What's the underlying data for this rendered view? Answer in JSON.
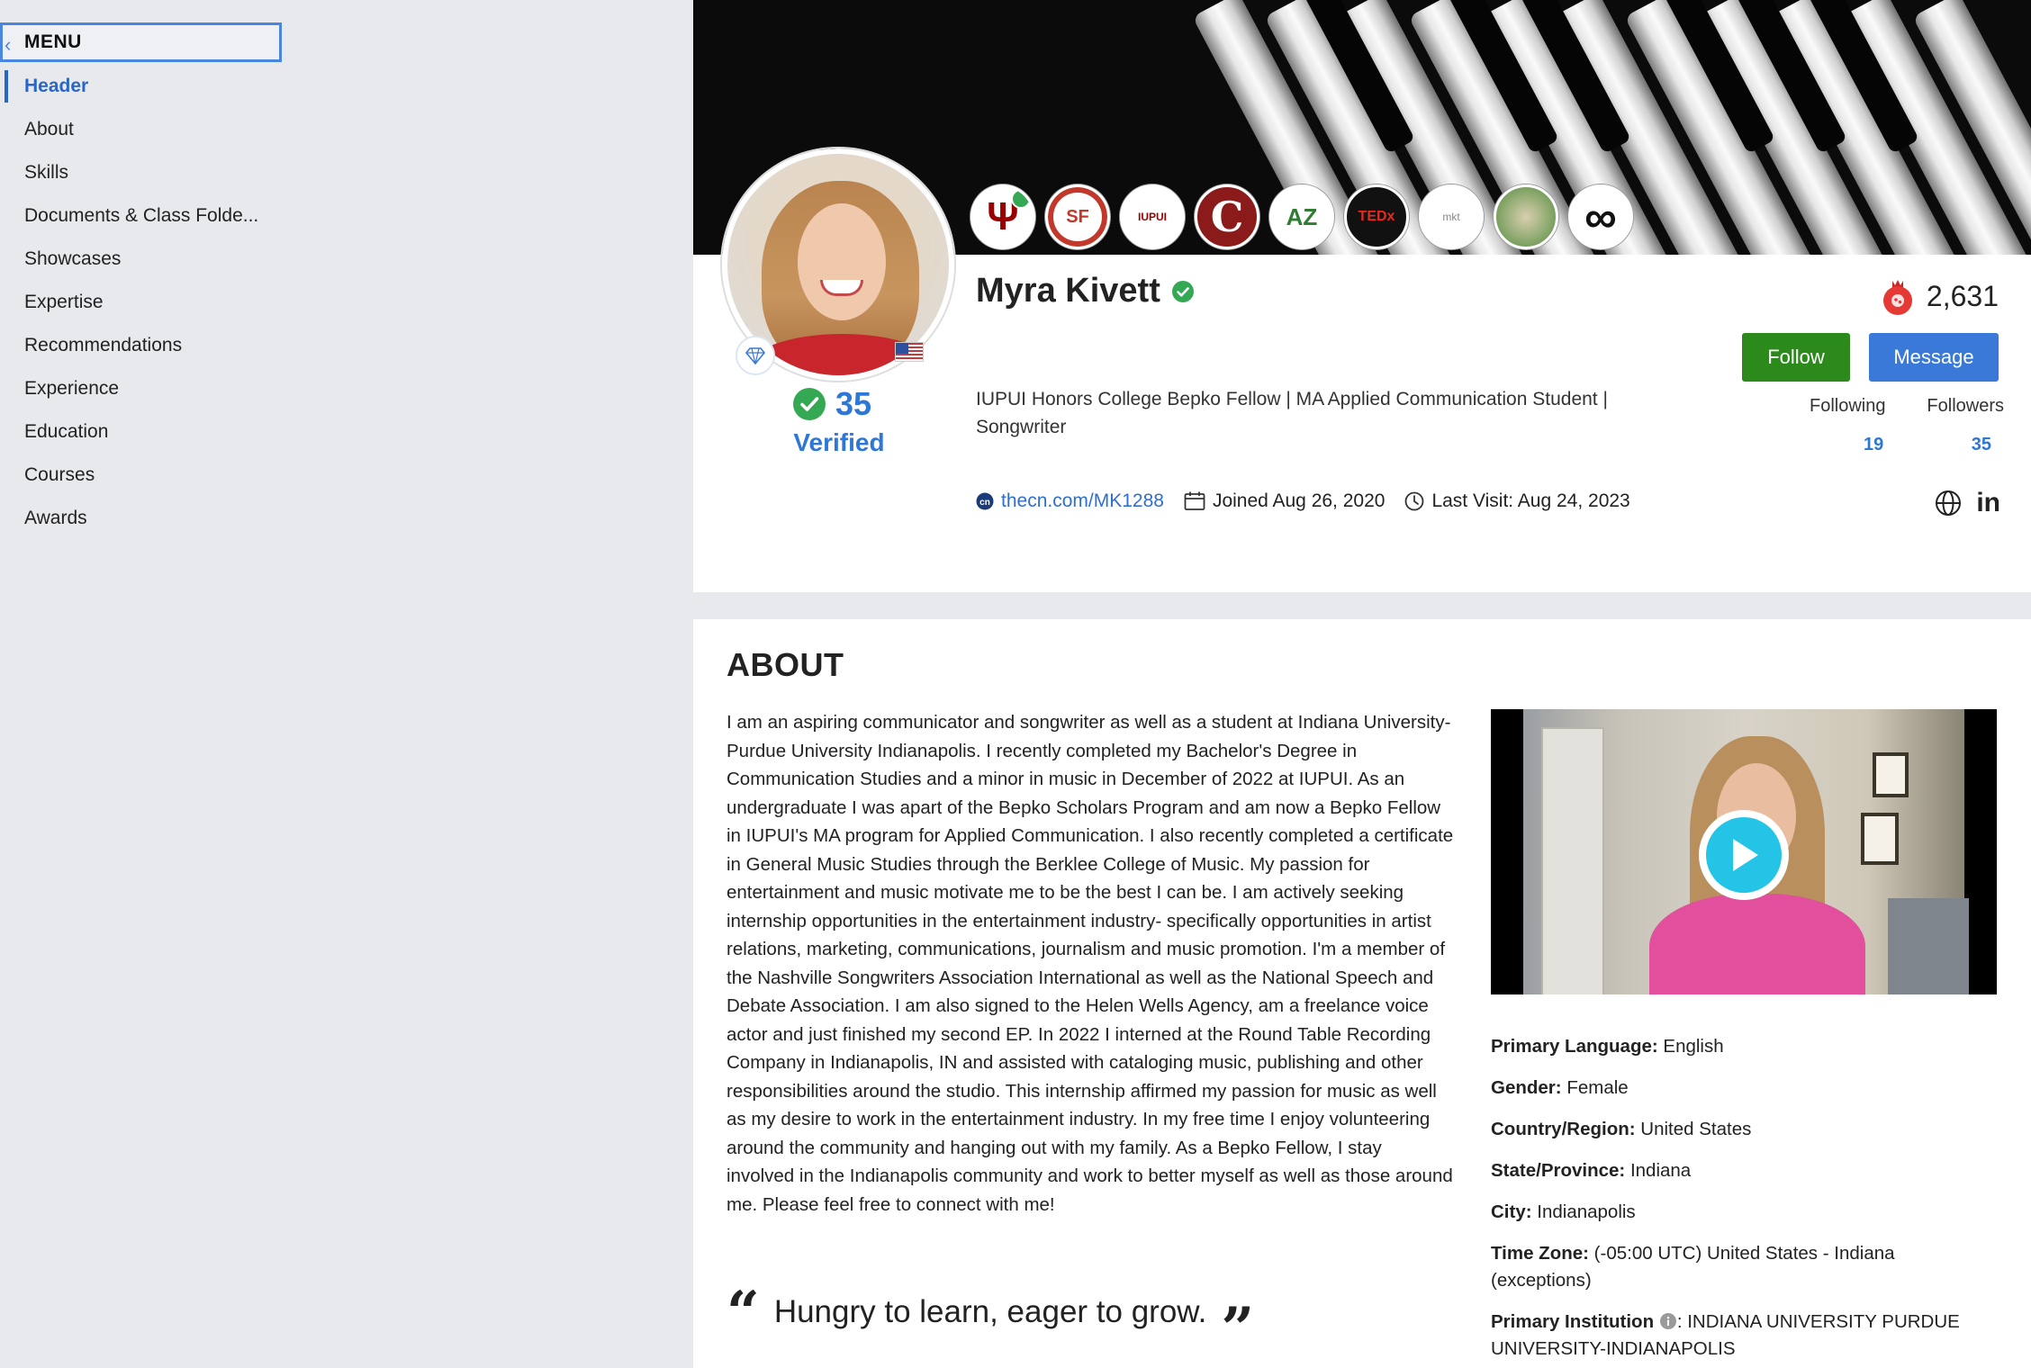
{
  "sidebar": {
    "menu_label": "MENU",
    "items": [
      {
        "label": "Header",
        "active": true
      },
      {
        "label": "About"
      },
      {
        "label": "Skills"
      },
      {
        "label": "Documents & Class Folde..."
      },
      {
        "label": "Showcases"
      },
      {
        "label": "Expertise"
      },
      {
        "label": "Recommendations"
      },
      {
        "label": "Experience"
      },
      {
        "label": "Education"
      },
      {
        "label": "Courses"
      },
      {
        "label": "Awards"
      }
    ]
  },
  "profile": {
    "name": "Myra Kivett",
    "score": "35",
    "verified_label": "Verified",
    "headline": "IUPUI Honors College Bepko Fellow | MA Applied Communication Student | Songwriter",
    "profile_link": "thecn.com/MK1288",
    "joined": "Joined Aug 26, 2020",
    "last_visit": "Last Visit: Aug 24, 2023",
    "points": "2,631",
    "follow_label": "Follow",
    "message_label": "Message",
    "following_label": "Following",
    "followers_label": "Followers",
    "following_count": "19",
    "followers_count": "35",
    "linkedin_label": "in",
    "badges": [
      {
        "name": "iu-badge",
        "text": "Ψ",
        "color": "#990000"
      },
      {
        "name": "sf-badge",
        "text": "SF",
        "color": "#c0392b"
      },
      {
        "name": "iupui-honors-badge",
        "text": "IUPUI",
        "color": "#990000"
      },
      {
        "name": "c-badge",
        "text": "C",
        "color": "#8b1a1a"
      },
      {
        "name": "az-badge",
        "text": "AZ",
        "color": "#2e7d32"
      },
      {
        "name": "tedx-badge",
        "text": "TEDx",
        "color": "#e62b1e"
      },
      {
        "name": "marketing-club-badge",
        "text": "mkt",
        "color": "#888888"
      },
      {
        "name": "group-photo-badge",
        "text": "",
        "color": "#6b8e4e"
      },
      {
        "name": "infinity-badge",
        "text": "∞",
        "color": "#111111"
      }
    ]
  },
  "about": {
    "title": "ABOUT",
    "body": "I am an aspiring communicator and songwriter as well as a student at Indiana University-Purdue University Indianapolis. I recently completed my Bachelor's Degree in Communication Studies and a minor in music in December of 2022 at IUPUI. As an undergraduate I was apart of the Bepko Scholars Program and am now a Bepko Fellow in IUPUI's MA program for Applied Communication. I also recently completed a certificate in General Music Studies through the Berklee College of Music. My passion for entertainment and music motivate me to be the best I can be. I am actively seeking internship opportunities in the entertainment industry- specifically opportunities in artist relations, marketing, communications, journalism and music promotion. I'm a member of the Nashville Songwriters Association International as well as the National Speech and Debate Association. I am also signed to the Helen Wells Agency, am a freelance voice actor and just finished my second EP. In 2022 I interned at the Round Table Recording Company in Indianapolis, IN and assisted with cataloging music, publishing and other responsibilities around the studio. This internship affirmed my passion for music as well as my desire to work in the entertainment industry. In my free time I enjoy volunteering around the community and hanging out with my family. As a Bepko Fellow, I stay involved in the Indianapolis community and work to better myself as well as those around me. Please feel free to connect with me!",
    "quote": "Hungry to learn, eager to grow.",
    "quote_open": "“",
    "quote_close": "”",
    "info": [
      {
        "label": "Primary Language:",
        "value": "English"
      },
      {
        "label": "Gender:",
        "value": "Female"
      },
      {
        "label": "Country/Region:",
        "value": "United States"
      },
      {
        "label": "State/Province:",
        "value": "Indiana"
      },
      {
        "label": "City:",
        "value": "Indianapolis"
      },
      {
        "label": "Time Zone:",
        "value": "(-05:00 UTC) United States - Indiana (exceptions)"
      },
      {
        "label": "Primary Institution",
        "value": ": INDIANA UNIVERSITY PURDUE UNIVERSITY-INDIANAPOLIS"
      }
    ]
  },
  "colors": {
    "accent": "#2f77d6",
    "follow": "#2b8a1b",
    "message": "#3a79d8",
    "verified": "#34a853"
  }
}
